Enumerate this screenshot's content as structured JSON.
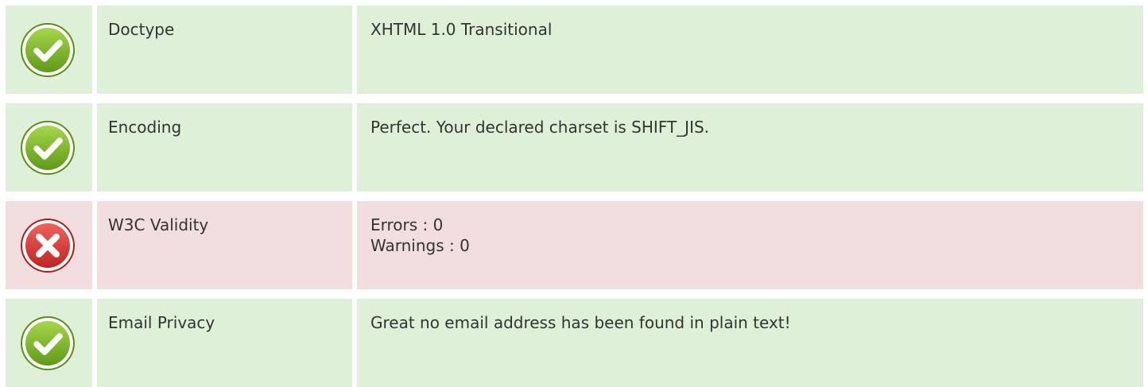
{
  "colors": {
    "pass_background": "#dff0d8",
    "fail_background": "#f2dede",
    "pass_icon": "#7fb82a",
    "fail_icon": "#d9322e"
  },
  "checks": [
    {
      "status": "pass",
      "icon": "check-circle-icon",
      "label": "Doctype",
      "lines": [
        "XHTML 1.0 Transitional"
      ]
    },
    {
      "status": "pass",
      "icon": "check-circle-icon",
      "label": "Encoding",
      "lines": [
        "Perfect. Your declared charset is SHIFT_JIS."
      ]
    },
    {
      "status": "fail",
      "icon": "cross-circle-icon",
      "label": "W3C Validity",
      "lines": [
        "Errors : 0",
        "Warnings : 0"
      ]
    },
    {
      "status": "pass",
      "icon": "check-circle-icon",
      "label": "Email Privacy",
      "lines": [
        "Great no email address has been found in plain text!"
      ]
    }
  ]
}
